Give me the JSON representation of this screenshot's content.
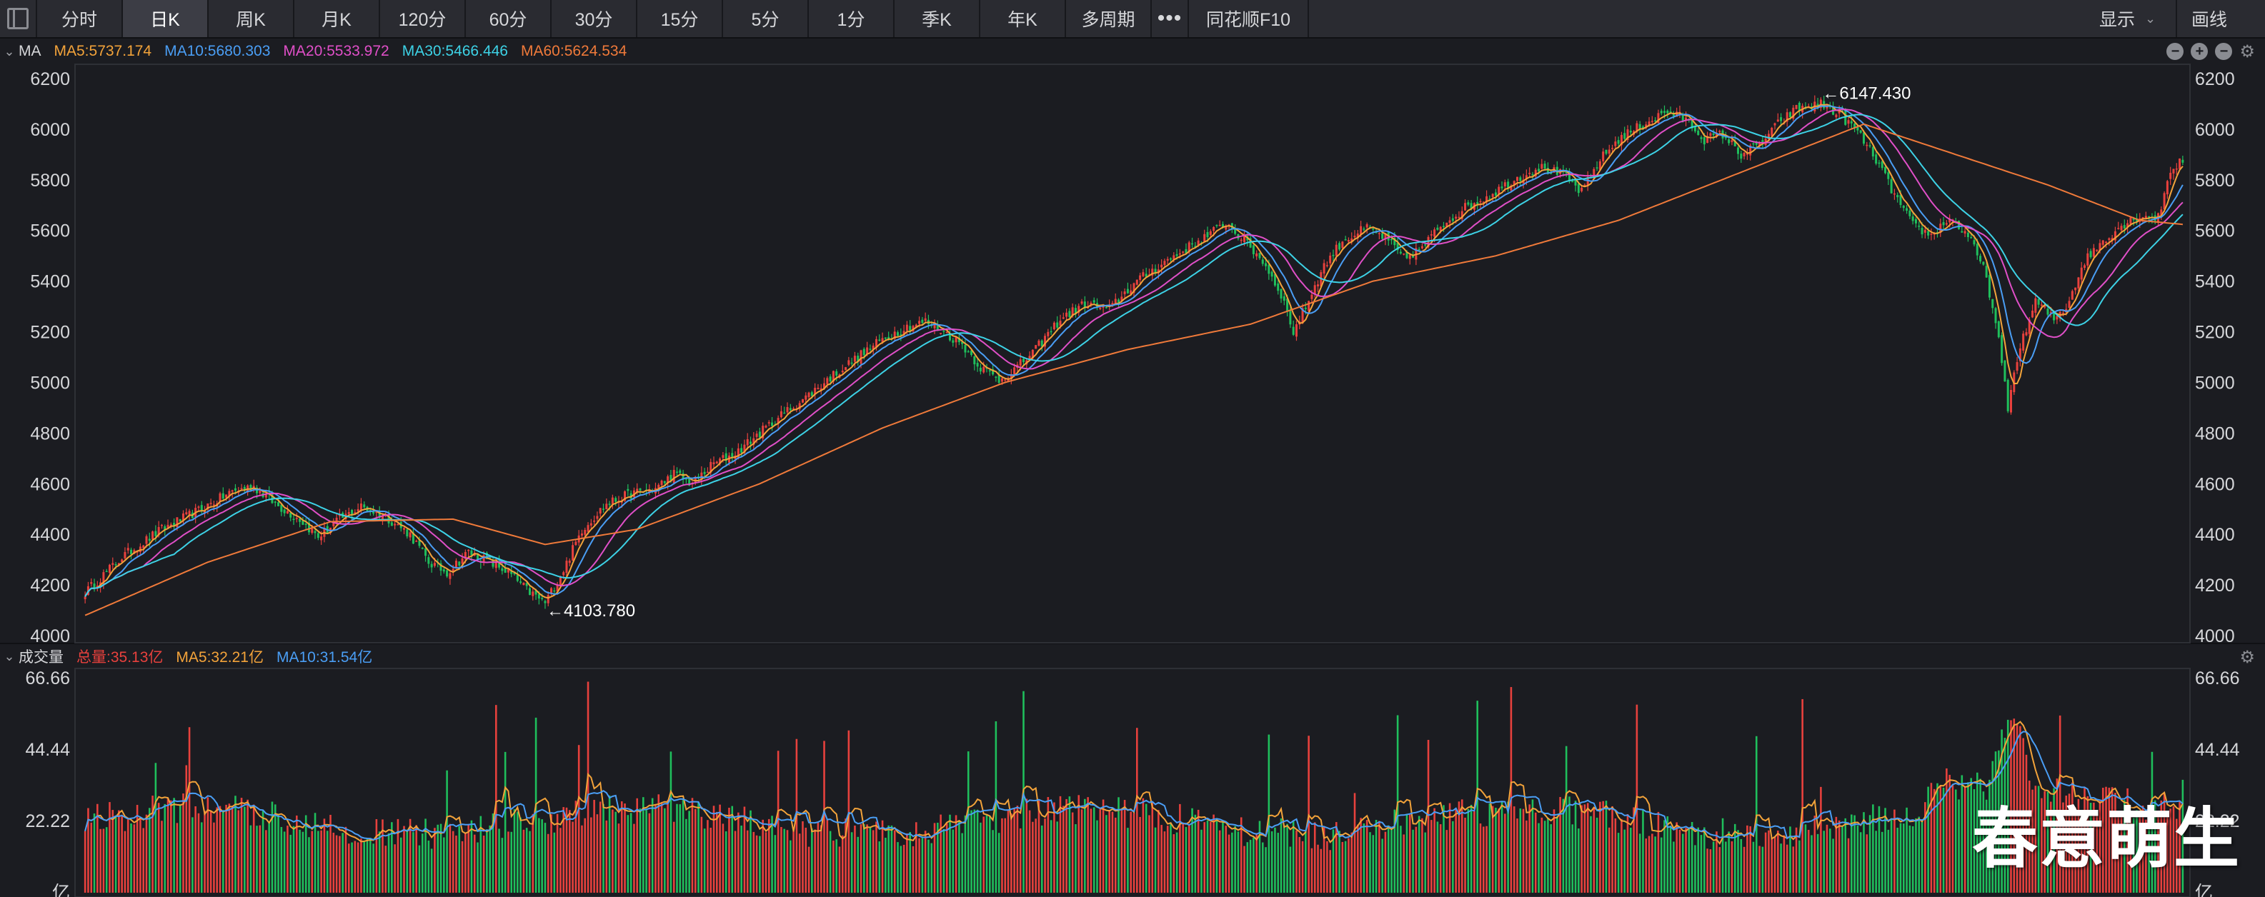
{
  "toolbar": {
    "tabs": [
      "分时",
      "日K",
      "周K",
      "月K",
      "120分",
      "60分",
      "30分",
      "15分",
      "5分",
      "1分",
      "季K",
      "年K",
      "多周期"
    ],
    "active_tab": "日K",
    "more": "•••",
    "f10": "同花顺F10",
    "display_label": "显示",
    "draw_label": "画线"
  },
  "price_legend": {
    "label": "MA",
    "ma5": "MA5:5737.174",
    "ma10": "MA10:5680.303",
    "ma20": "MA20:5533.972",
    "ma30": "MA30:5466.446",
    "ma60": "MA60:5624.534"
  },
  "volume_legend": {
    "label": "成交量",
    "total": "总量:35.13亿",
    "ma5": "MA5:32.21亿",
    "ma10": "MA10:31.54亿"
  },
  "watermark": "春意萌生",
  "colors": {
    "up": "#e8413d",
    "down": "#1fbf5c",
    "ma5": "#f3a33a",
    "ma10": "#4a9ef5",
    "ma20": "#e04fc8",
    "ma30": "#3dd2e6",
    "ma60": "#f07a3a",
    "total": "#e8413d"
  },
  "chart_data": [
    {
      "type": "candlestick",
      "title": "",
      "ylim": [
        4000,
        6200
      ],
      "yticks": [
        "6200",
        "6000",
        "5800",
        "5600",
        "5400",
        "5200",
        "5000",
        "4800",
        "4600",
        "4400",
        "4200",
        "4000"
      ],
      "annotations": [
        {
          "label": "←6147.430",
          "value": 6147.43
        },
        {
          "label": "←4103.780",
          "value": 4103.78
        }
      ],
      "close_path": [
        [
          0,
          4170
        ],
        [
          12,
          4310
        ],
        [
          25,
          4420
        ],
        [
          38,
          4500
        ],
        [
          48,
          4570
        ],
        [
          55,
          4590
        ],
        [
          62,
          4520
        ],
        [
          70,
          4460
        ],
        [
          76,
          4390
        ],
        [
          82,
          4450
        ],
        [
          90,
          4510
        ],
        [
          98,
          4470
        ],
        [
          106,
          4400
        ],
        [
          112,
          4290
        ],
        [
          118,
          4250
        ],
        [
          125,
          4330
        ],
        [
          132,
          4290
        ],
        [
          138,
          4250
        ],
        [
          144,
          4180
        ],
        [
          150,
          4130
        ],
        [
          156,
          4260
        ],
        [
          162,
          4420
        ],
        [
          170,
          4520
        ],
        [
          178,
          4560
        ],
        [
          186,
          4580
        ],
        [
          192,
          4640
        ],
        [
          198,
          4600
        ],
        [
          205,
          4680
        ],
        [
          212,
          4720
        ],
        [
          220,
          4800
        ],
        [
          228,
          4880
        ],
        [
          236,
          4950
        ],
        [
          244,
          5030
        ],
        [
          252,
          5100
        ],
        [
          260,
          5170
        ],
        [
          268,
          5220
        ],
        [
          274,
          5240
        ],
        [
          280,
          5200
        ],
        [
          286,
          5150
        ],
        [
          292,
          5060
        ],
        [
          298,
          5010
        ],
        [
          304,
          5060
        ],
        [
          310,
          5130
        ],
        [
          318,
          5250
        ],
        [
          326,
          5310
        ],
        [
          334,
          5290
        ],
        [
          342,
          5390
        ],
        [
          350,
          5460
        ],
        [
          358,
          5520
        ],
        [
          366,
          5580
        ],
        [
          372,
          5630
        ],
        [
          378,
          5560
        ],
        [
          384,
          5480
        ],
        [
          390,
          5350
        ],
        [
          394,
          5200
        ],
        [
          398,
          5300
        ],
        [
          404,
          5460
        ],
        [
          410,
          5560
        ],
        [
          418,
          5610
        ],
        [
          424,
          5570
        ],
        [
          430,
          5490
        ],
        [
          436,
          5530
        ],
        [
          442,
          5620
        ],
        [
          450,
          5690
        ],
        [
          458,
          5740
        ],
        [
          466,
          5800
        ],
        [
          474,
          5850
        ],
        [
          482,
          5820
        ],
        [
          488,
          5750
        ],
        [
          494,
          5880
        ],
        [
          500,
          5960
        ],
        [
          508,
          6020
        ],
        [
          516,
          6070
        ],
        [
          522,
          6040
        ],
        [
          528,
          5960
        ],
        [
          534,
          5980
        ],
        [
          540,
          5900
        ],
        [
          546,
          5940
        ],
        [
          552,
          6020
        ],
        [
          558,
          6080
        ],
        [
          566,
          6100
        ],
        [
          572,
          6060
        ],
        [
          578,
          5990
        ],
        [
          584,
          5880
        ],
        [
          590,
          5740
        ],
        [
          596,
          5620
        ],
        [
          602,
          5580
        ],
        [
          608,
          5650
        ],
        [
          614,
          5580
        ],
        [
          620,
          5420
        ],
        [
          624,
          5160
        ],
        [
          627,
          4900
        ],
        [
          630,
          5100
        ],
        [
          636,
          5320
        ],
        [
          642,
          5250
        ],
        [
          646,
          5300
        ],
        [
          652,
          5480
        ],
        [
          658,
          5560
        ],
        [
          664,
          5620
        ],
        [
          670,
          5660
        ],
        [
          676,
          5650
        ],
        [
          680,
          5840
        ],
        [
          684,
          5880
        ]
      ],
      "n_bars": 685,
      "ma60_path": [
        [
          0,
          4080
        ],
        [
          40,
          4290
        ],
        [
          80,
          4450
        ],
        [
          120,
          4460
        ],
        [
          150,
          4360
        ],
        [
          180,
          4420
        ],
        [
          220,
          4600
        ],
        [
          260,
          4820
        ],
        [
          300,
          5000
        ],
        [
          340,
          5130
        ],
        [
          380,
          5230
        ],
        [
          420,
          5400
        ],
        [
          460,
          5500
        ],
        [
          500,
          5640
        ],
        [
          540,
          5830
        ],
        [
          580,
          6020
        ],
        [
          610,
          5900
        ],
        [
          640,
          5780
        ],
        [
          670,
          5640
        ],
        [
          684,
          5624
        ]
      ]
    },
    {
      "type": "bar",
      "title": "",
      "unit": "亿",
      "ylim": [
        0,
        66.66
      ],
      "yticks": [
        "66.66",
        "44.44",
        "22.22",
        "亿"
      ],
      "last_total": 35.13,
      "ma5": 32.21,
      "ma10": 31.54
    }
  ]
}
